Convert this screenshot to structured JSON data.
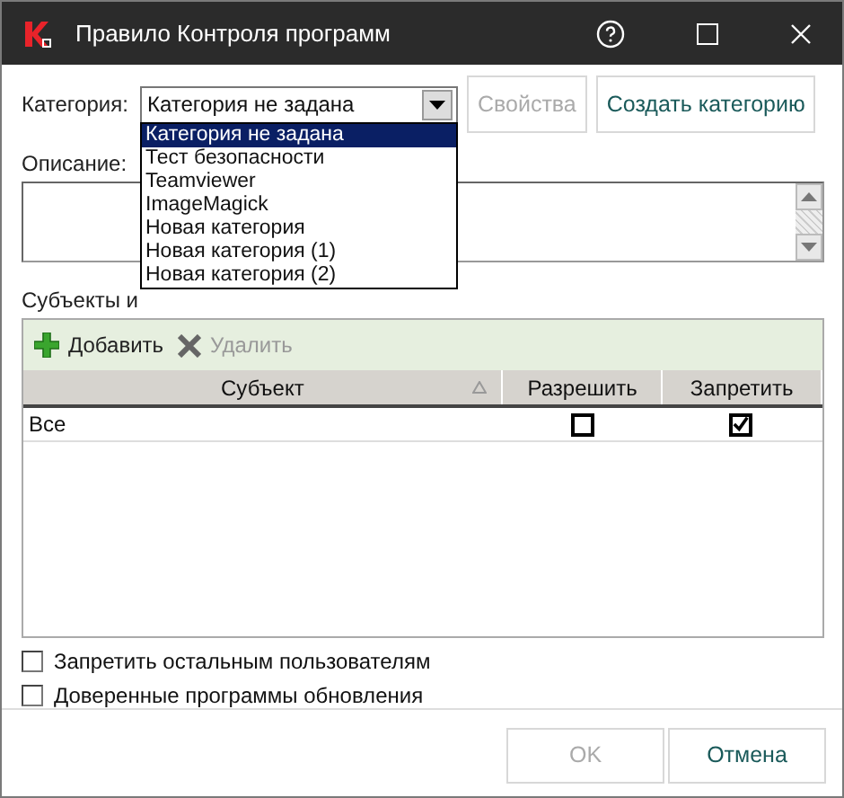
{
  "window": {
    "title": "Правило Контроля программ"
  },
  "category": {
    "label": "Категория:",
    "value": "Категория не задана",
    "options": [
      {
        "label": "Категория не задана",
        "selected": true
      },
      {
        "label": "Тест безопасности",
        "selected": false
      },
      {
        "label": "Teamviewer",
        "selected": false
      },
      {
        "label": "ImageMagick",
        "selected": false
      },
      {
        "label": "Новая категория",
        "selected": false
      },
      {
        "label": "Новая категория (1)",
        "selected": false
      },
      {
        "label": "Новая категория (2)",
        "selected": false
      }
    ],
    "buttons": [
      {
        "label": "Свойства",
        "disabled": true
      },
      {
        "label": "Создать категорию",
        "disabled": false
      }
    ]
  },
  "description": {
    "label": "Описание:"
  },
  "subjects": {
    "label": "Субъекты и",
    "toolbar": [
      {
        "kind": "add",
        "label": "Добавить",
        "disabled": false
      },
      {
        "kind": "delete",
        "label": "Удалить",
        "disabled": true
      }
    ],
    "columns": [
      "Субъект",
      "Разрешить",
      "Запретить"
    ],
    "rows": [
      {
        "subject": "Все",
        "allow": false,
        "deny": true
      }
    ]
  },
  "options": [
    {
      "label": "Запретить остальным пользователям",
      "checked": false
    },
    {
      "label": "Доверенные программы обновления",
      "checked": false
    }
  ],
  "buttons": [
    {
      "label": "OK",
      "disabled": true
    },
    {
      "label": "Отмена",
      "disabled": false
    }
  ]
}
